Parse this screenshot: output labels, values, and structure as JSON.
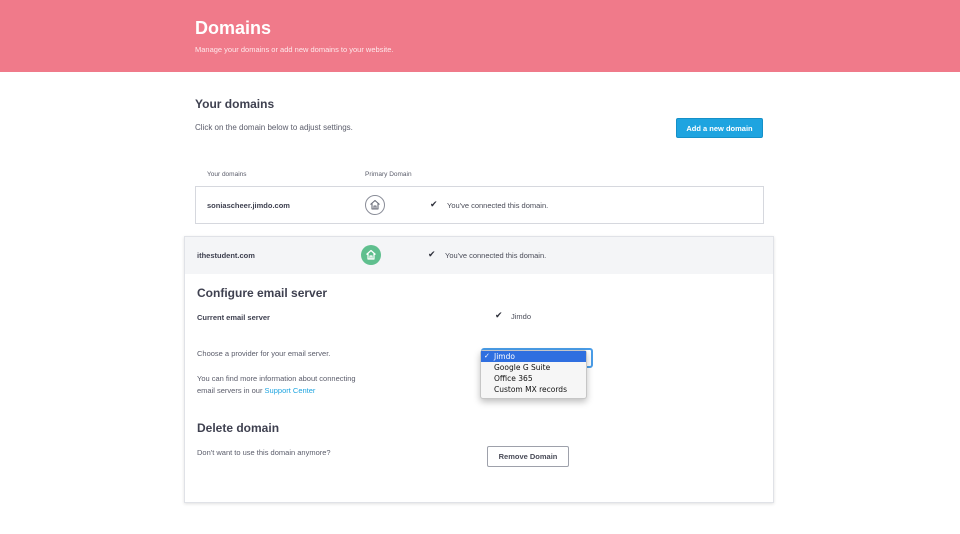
{
  "header": {
    "title": "Domains",
    "subtitle": "Manage your domains or add new domains to your website."
  },
  "your_domains": {
    "title": "Your domains",
    "hint": "Click on the domain below to adjust settings.",
    "add_button": "Add a new domain",
    "columns": [
      "Your domains",
      "Primary Domain"
    ]
  },
  "domains": [
    {
      "name": "soniascheer.jimdo.com",
      "status": "You've connected this domain.",
      "icon": "home-icon",
      "primary": false
    },
    {
      "name": "ithestudent.com",
      "status": "You've connected this domain.",
      "icon": "home-icon",
      "primary": true
    }
  ],
  "email": {
    "title": "Configure email server",
    "current_label": "Current email server",
    "current_value": "Jimdo",
    "choose_text": "Choose a provider for your email server.",
    "info_line1": "You can find more information about connecting",
    "info_line2_prefix": "email servers in our",
    "support_link": "Support Center",
    "options": [
      "Jimdo",
      "Google G Suite",
      "Office 365",
      "Custom MX records"
    ],
    "selected_option": "Jimdo"
  },
  "delete": {
    "title": "Delete domain",
    "text": "Don't want to use this domain anymore?",
    "button": "Remove Domain"
  },
  "colors": {
    "header_bg": "#f07a8a",
    "accent": "#1ea4e0",
    "primary_home": "#5fbf8e",
    "select_highlight": "#2f6fe0"
  }
}
